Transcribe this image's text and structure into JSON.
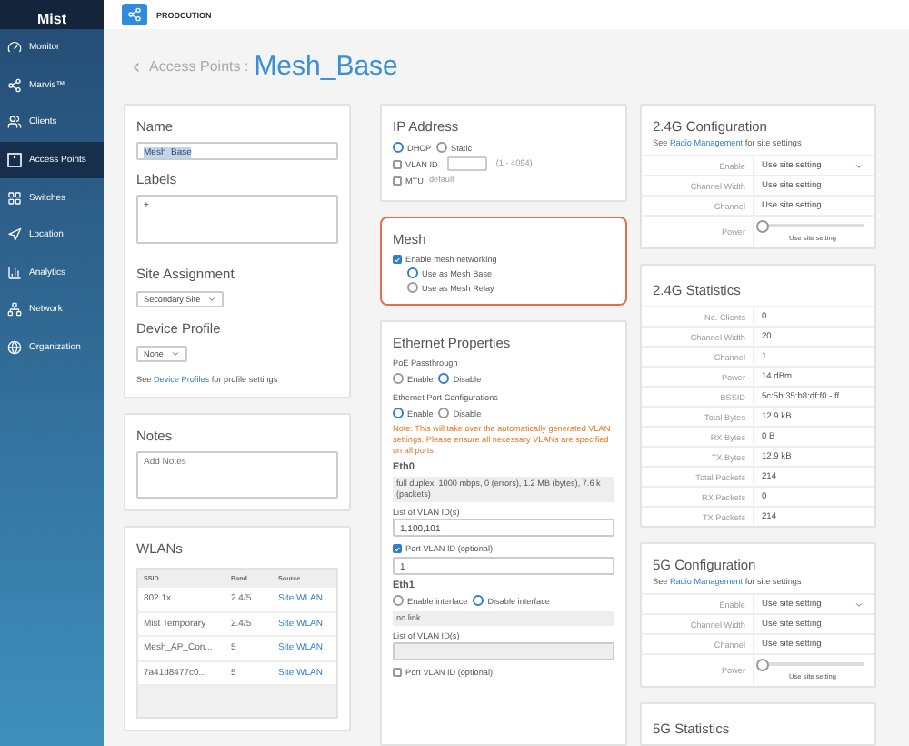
{
  "sidebar": {
    "logo": "Mist",
    "items": [
      {
        "label": "Monitor",
        "selected": false
      },
      {
        "label": "Marvis™",
        "selected": false
      },
      {
        "label": "Clients",
        "selected": false
      },
      {
        "label": "Access Points",
        "selected": true
      },
      {
        "label": "Switches",
        "selected": false
      },
      {
        "label": "Location",
        "selected": false
      },
      {
        "label": "Analytics",
        "selected": false
      },
      {
        "label": "Network",
        "selected": false
      },
      {
        "label": "Organization",
        "selected": false
      }
    ]
  },
  "topbar": {
    "site": "PRODCUTION"
  },
  "header": {
    "parent": "Access Points :",
    "title": "Mesh_Base"
  },
  "device_card": {
    "name_label": "Name",
    "name_value": "Mesh_Base",
    "labels_label": "Labels",
    "labels_add": "+",
    "site_label": "Site Assignment",
    "site_value": "Secondary Site",
    "profile_label": "Device Profile",
    "profile_value": "None",
    "profile_note": {
      "before": "See",
      "link": "Device Profiles",
      "after": "for profile settings"
    }
  },
  "notes_card": {
    "title": "Notes",
    "placeholder": "Add Notes"
  },
  "wlans_card": {
    "title": "WLANs",
    "columns": [
      "SSID",
      "Band",
      "Source"
    ],
    "rows": [
      [
        "802.1x",
        "2.4/5",
        "Site WLAN"
      ],
      [
        "Mist Temporary",
        "2.4/5",
        "Site WLAN"
      ],
      [
        "Mesh_AP_Con...",
        "5",
        "Site WLAN"
      ],
      [
        "7a41d8477c0...",
        "5",
        "Site WLAN"
      ]
    ]
  },
  "ip_card": {
    "title": "IP Address",
    "modes": [
      {
        "label": "DHCP",
        "selected": true
      },
      {
        "label": "Static",
        "selected": false
      }
    ],
    "vlan": {
      "label": "VLAN ID",
      "checked": false,
      "hint": "(1 - 4094)"
    },
    "mtu": {
      "label": "MTU",
      "checked": false,
      "value": "default"
    }
  },
  "mesh_card": {
    "title": "Mesh",
    "enable": {
      "label": "Enable mesh networking",
      "checked": true
    },
    "roles": [
      {
        "label": "Use as Mesh Base",
        "selected": true
      },
      {
        "label": "Use as Mesh Relay",
        "selected": false
      }
    ]
  },
  "ethernet_card": {
    "title": "Ethernet Properties",
    "poe": {
      "label": "PoE Passthrough",
      "options": [
        {
          "label": "Enable",
          "selected": false
        },
        {
          "label": "Disable",
          "selected": true
        }
      ]
    },
    "port_config": {
      "label": "Ethernet Port Configurations",
      "options": [
        {
          "label": "Enable",
          "selected": true
        },
        {
          "label": "Disable",
          "selected": false
        }
      ]
    },
    "note": "Note: This will take over the automatically generated VLAN settings. Please ensure all necessary VLANs are specified on all ports.",
    "eth0": {
      "name": "Eth0",
      "status": "full duplex, 1000 mbps, 0 (errors), 1.2 MB (bytes), 7.6 k (packets)",
      "vlan_label": "List of VLAN ID(s)",
      "vlan_value": "1,100,101",
      "pvid": {
        "label": "Port VLAN ID (optional)",
        "checked": true,
        "value": "1"
      }
    },
    "eth1": {
      "name": "Eth1",
      "options": [
        {
          "label": "Enable interface",
          "selected": false
        },
        {
          "label": "Disable interface",
          "selected": true
        }
      ],
      "status": "no link",
      "vlan_label": "List of VLAN ID(s)",
      "pvid": {
        "label": "Port VLAN ID (optional)",
        "checked": false
      }
    }
  },
  "radio_cards": [
    {
      "kind": "config",
      "title": "2.4G Configuration",
      "note": {
        "before": "See",
        "link": "Radio Management",
        "after": "for site settings"
      },
      "rows": [
        {
          "kind": "select",
          "label": "Enable",
          "value": "Use site setting"
        },
        {
          "kind": "text",
          "label": "Channel Width",
          "value": "Use site setting"
        },
        {
          "kind": "text",
          "label": "Channel",
          "value": "Use site setting"
        },
        {
          "kind": "slider",
          "label": "Power",
          "level": 0,
          "caption": "Use site setting"
        }
      ]
    },
    {
      "kind": "stats",
      "title": "2.4G Statistics",
      "rows": [
        {
          "label": "No. Clients",
          "value": "0"
        },
        {
          "label": "Channel Width",
          "value": "20"
        },
        {
          "label": "Channel",
          "value": "1"
        },
        {
          "label": "Power",
          "value": "14 dBm"
        },
        {
          "label": "BSSID",
          "value": "5c:5b:35:b8:df:f0 - ff"
        },
        {
          "label": "Total Bytes",
          "value": "12.9 kB"
        },
        {
          "label": "RX Bytes",
          "value": "0 B"
        },
        {
          "label": "TX Bytes",
          "value": "12.9 kB"
        },
        {
          "label": "Total Packets",
          "value": "214"
        },
        {
          "label": "RX Packets",
          "value": "0"
        },
        {
          "label": "TX Packets",
          "value": "214"
        }
      ]
    },
    {
      "kind": "config",
      "title": "5G Configuration",
      "note": {
        "before": "See",
        "link": "Radio Management",
        "after": "for site settings"
      },
      "rows": [
        {
          "kind": "select",
          "label": "Enable",
          "value": "Use site setting"
        },
        {
          "kind": "text",
          "label": "Channel Width",
          "value": "Use site setting"
        },
        {
          "kind": "text",
          "label": "Channel",
          "value": "Use site setting"
        },
        {
          "kind": "slider",
          "label": "Power",
          "level": 0,
          "caption": "Use site setting"
        }
      ]
    },
    {
      "kind": "stats",
      "title": "5G Statistics"
    }
  ]
}
